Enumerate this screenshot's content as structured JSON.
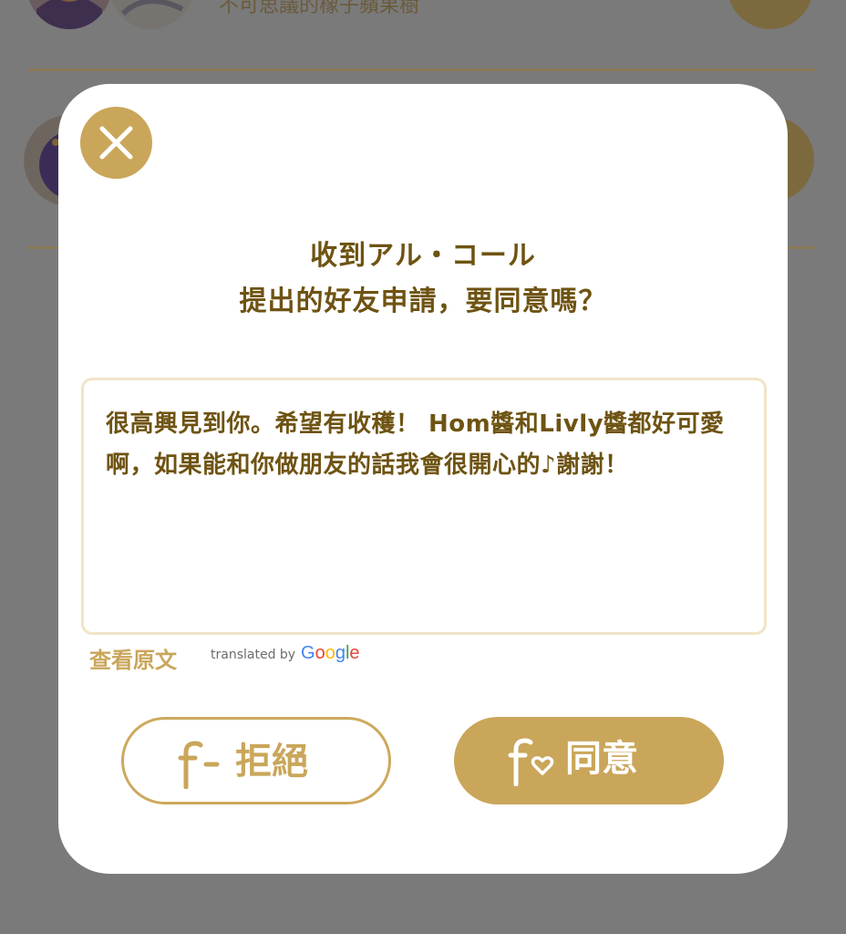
{
  "background": {
    "row1_name": "不可思議的橡子蘋果樹"
  },
  "dialog": {
    "title_line1": "收到アル・コール",
    "title_line2": "提出的好友申請，要同意嗎？",
    "message": "很高興見到你。希望有收穫！ Hom醬和Livly醬都好可愛啊，如果能和你做朋友的話我會很開心的♪謝謝！",
    "view_original": "查看原文",
    "translated_by": "translated by",
    "google_letters": [
      {
        "ch": "G",
        "color": "#4285F4"
      },
      {
        "ch": "o",
        "color": "#EA4335"
      },
      {
        "ch": "o",
        "color": "#FBBC05"
      },
      {
        "ch": "g",
        "color": "#4285F4"
      },
      {
        "ch": "l",
        "color": "#34A853"
      },
      {
        "ch": "e",
        "color": "#EA4335"
      }
    ],
    "reject_label": "拒絕",
    "accept_label": "同意",
    "icons": {
      "close": "close-icon",
      "reject": "friend-remove-icon",
      "accept": "friend-heart-icon"
    }
  },
  "colors": {
    "accent_gold": "#c9a65a",
    "text_brown": "#6e5312",
    "overlay": "#7a7a7a",
    "modal_bg": "#ffffff"
  }
}
